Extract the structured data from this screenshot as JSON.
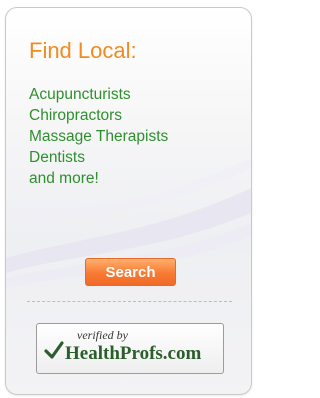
{
  "widget": {
    "title": "Find Local:",
    "links": [
      "Acupuncturists",
      "Chiropractors",
      "Massage Therapists",
      "Dentists",
      "and more!"
    ],
    "search_label": "Search",
    "badge": {
      "verified_text": "verified by",
      "brand_text": "HealthProfs.com"
    }
  },
  "colors": {
    "title": "#f28b1f",
    "links": "#2f8f2f",
    "button": "#f97a33",
    "badge_brand": "#2b5e2b"
  }
}
